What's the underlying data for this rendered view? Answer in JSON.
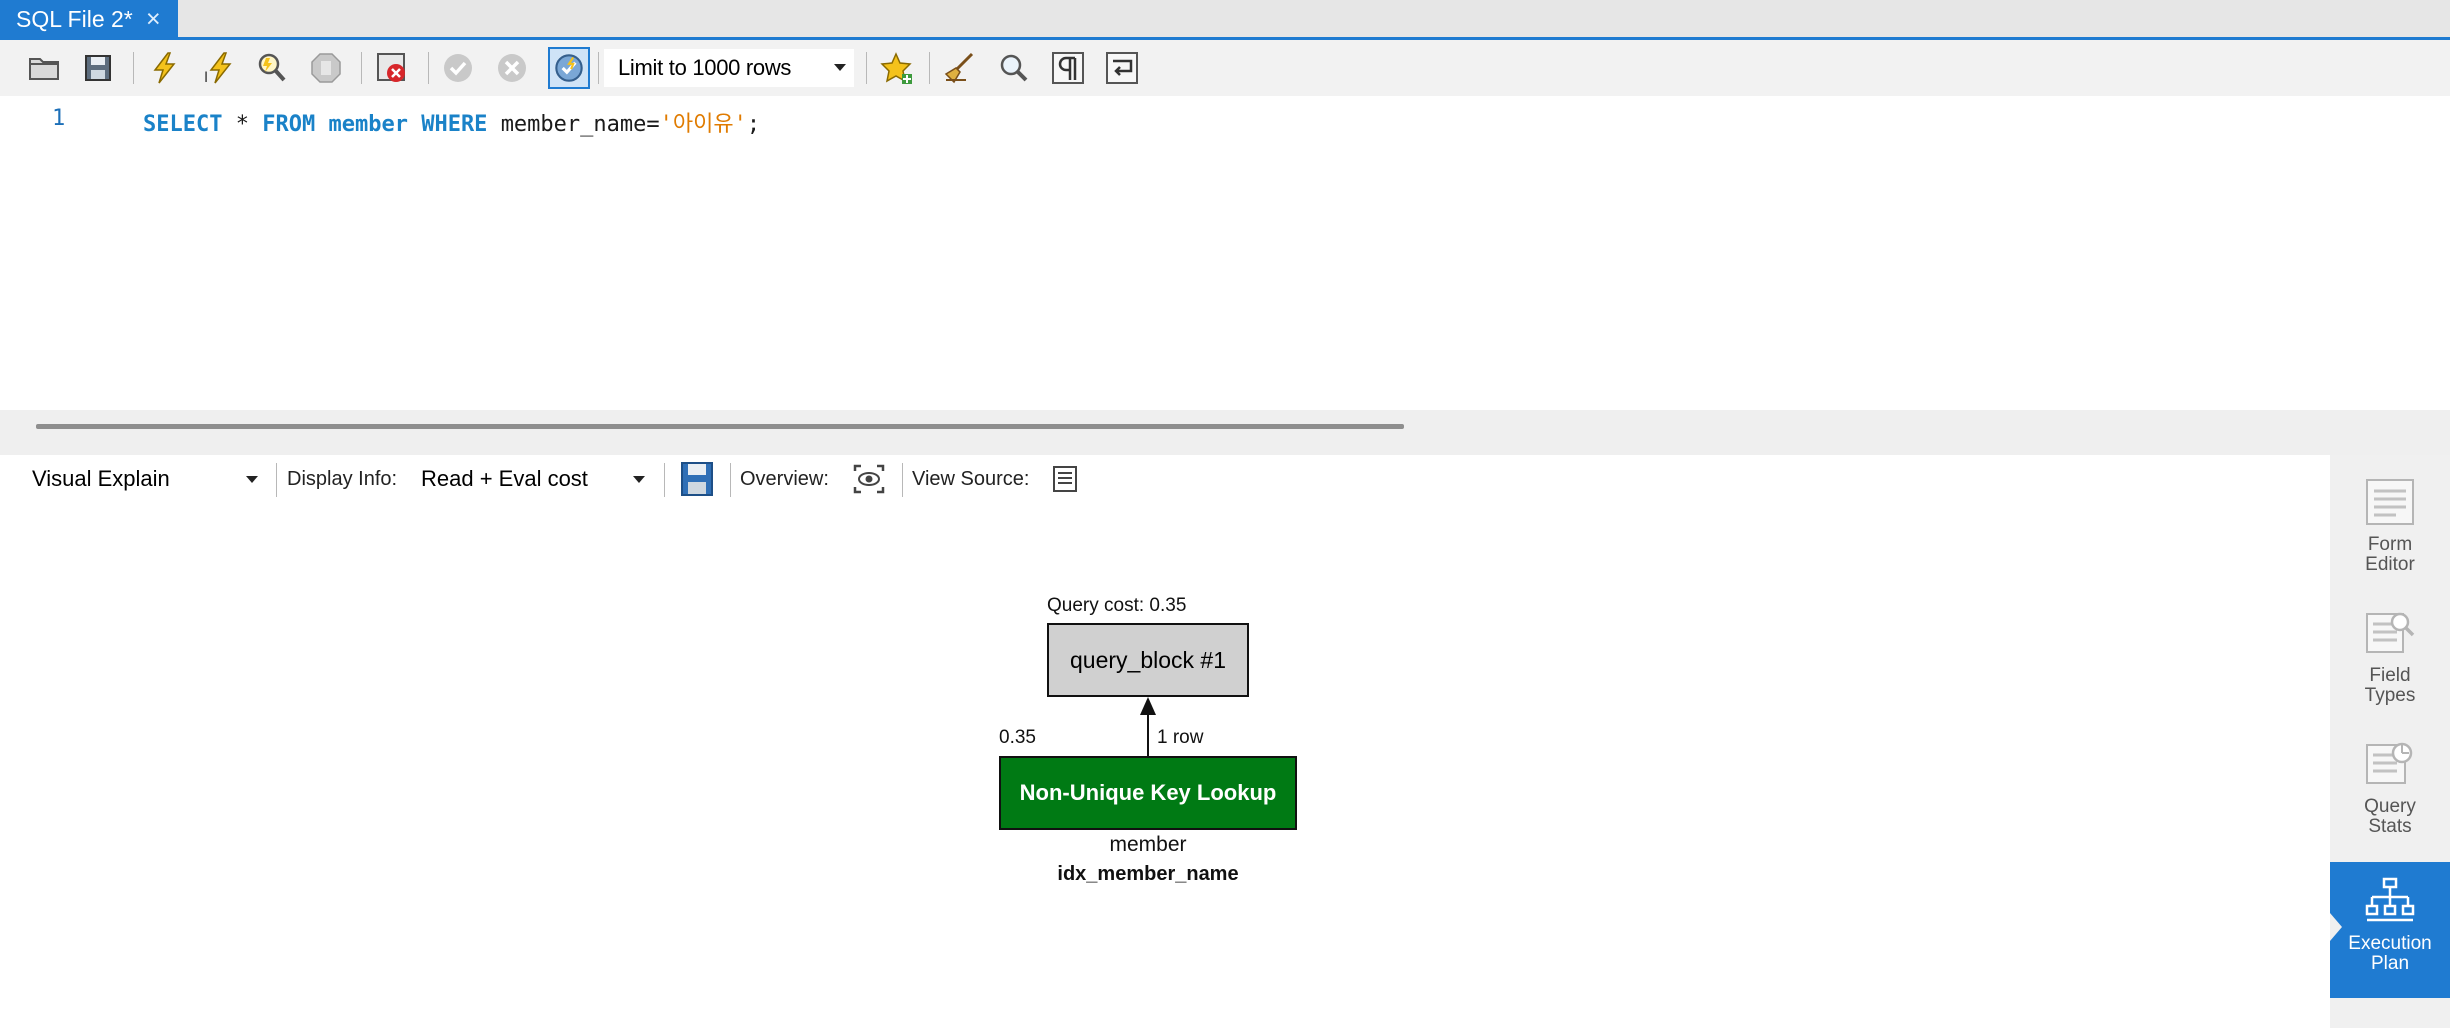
{
  "tab": {
    "title": "SQL File 2*",
    "close": "×"
  },
  "toolbar": {
    "limit_label": "Limit to 1000 rows",
    "icons": [
      "open-folder-icon",
      "save-icon",
      "execute-icon",
      "execute-current-icon",
      "explain-icon",
      "stop-icon",
      "toggle-error-stop-icon",
      "commit-icon",
      "rollback-icon",
      "autocommit-icon",
      "bookmark-icon",
      "beautify-icon",
      "find-icon",
      "invisible-chars-icon",
      "wrap-lines-icon"
    ]
  },
  "editor": {
    "line_number": "1",
    "tokens": {
      "select": "SELECT",
      "star": " * ",
      "from": "FROM",
      "table": "member",
      "where": "WHERE",
      "column": "member_name=",
      "quote_open": "'",
      "value": "아이유",
      "quote_close": "'",
      "semicolon": ";"
    }
  },
  "explain_bar": {
    "view_mode": "Visual Explain",
    "display_info_label": "Display Info:",
    "display_info_value": "Read + Eval cost",
    "overview_label": "Overview:",
    "view_source_label": "View Source:"
  },
  "diagram": {
    "query_cost": "Query cost: 0.35",
    "query_block": "query_block #1",
    "edge_cost": "0.35",
    "edge_rows": "1 row",
    "lookup_label": "Non-Unique Key Lookup",
    "table_name": "member",
    "index_name": "idx_member_name",
    "colors": {
      "lookup": "#007a14",
      "query_block": "#d0d0d0"
    }
  },
  "side_panel": {
    "items": [
      {
        "label_1": "Form",
        "label_2": "Editor",
        "icon": "form-editor-icon"
      },
      {
        "label_1": "Field",
        "label_2": "Types",
        "icon": "field-types-icon"
      },
      {
        "label_1": "Query",
        "label_2": "Stats",
        "icon": "query-stats-icon"
      },
      {
        "label_1": "Execution",
        "label_2": "Plan",
        "icon": "execution-plan-icon",
        "active": true
      }
    ]
  },
  "colors": {
    "accent": "#1f7bd1",
    "keyword": "#1a82c8",
    "string": "#e07b00"
  }
}
